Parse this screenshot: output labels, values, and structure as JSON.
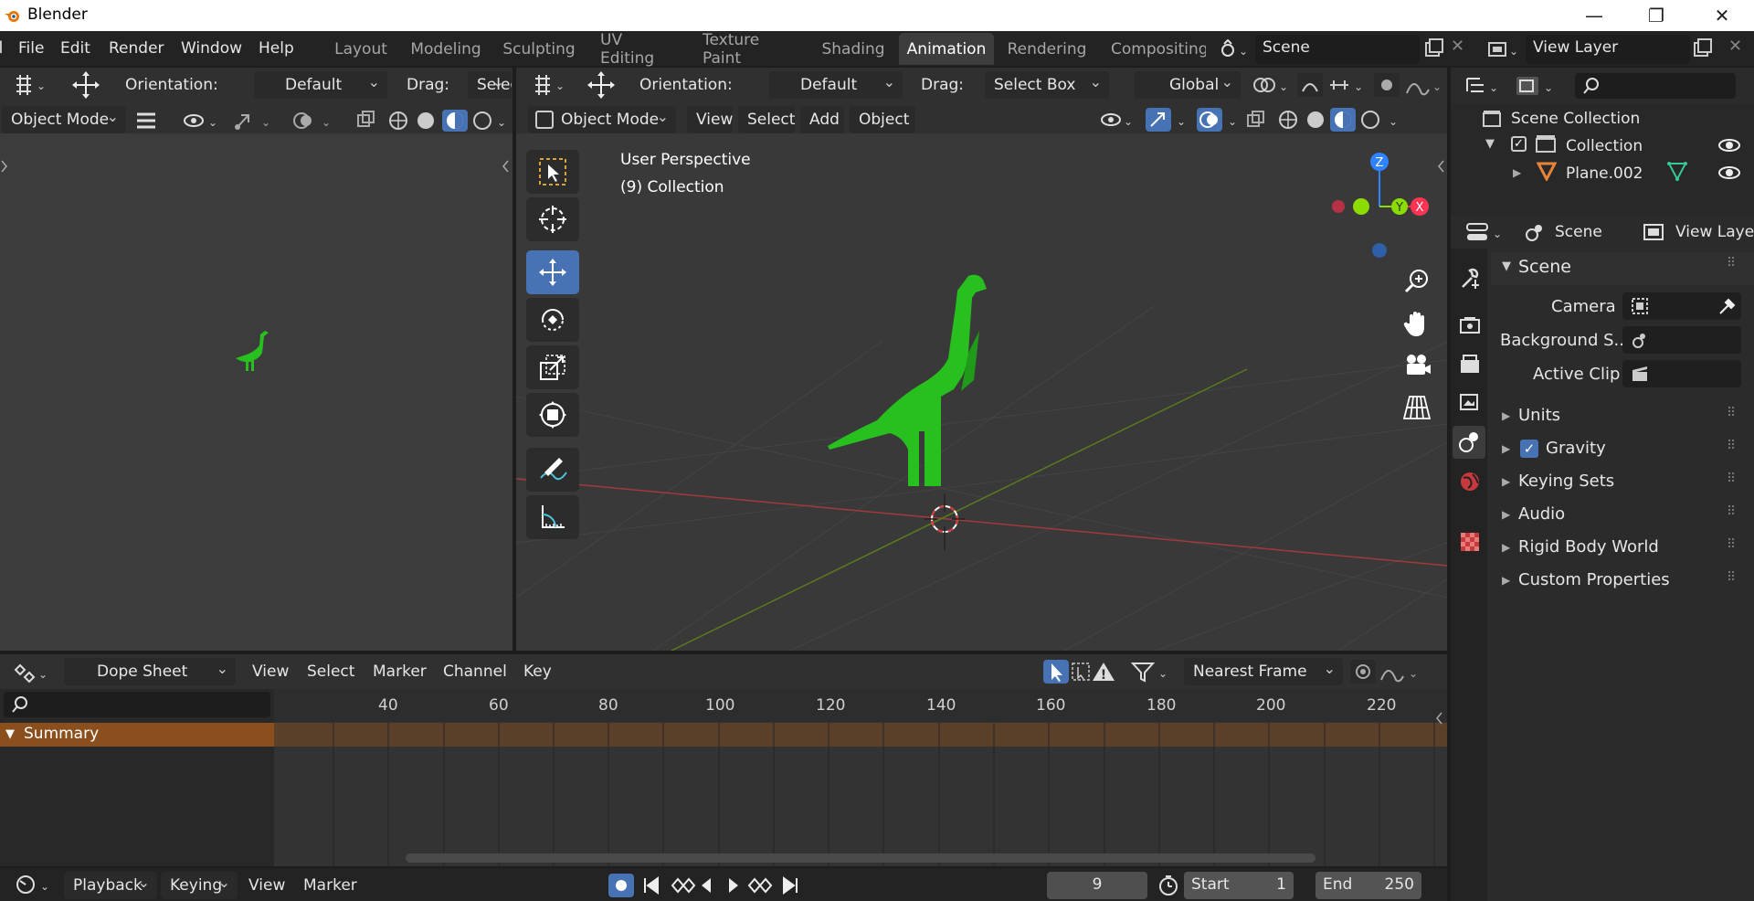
{
  "window": {
    "title": "Blender",
    "minimize": "—",
    "restore": "❐",
    "close": "✕"
  },
  "menu": [
    "File",
    "Edit",
    "Render",
    "Window",
    "Help"
  ],
  "workspaces": {
    "tabs": [
      "Layout",
      "Modeling",
      "Sculpting",
      "UV Editing",
      "Texture Paint",
      "Shading",
      "Animation",
      "Rendering",
      "Compositing"
    ],
    "active": "Animation"
  },
  "scene_selector": {
    "label": "Scene"
  },
  "view_layer_selector": {
    "label": "View Layer"
  },
  "left_viewport": {
    "orientation_label": "Orientation:",
    "orientation_value": "Default",
    "drag_label": "Drag:",
    "drag_value": "Selec",
    "mode": "Object Mode"
  },
  "main_viewport": {
    "orientation_label": "Orientation:",
    "orientation_value": "Default",
    "drag_label": "Drag:",
    "drag_value": "Select Box",
    "transform_space": "Global",
    "mode": "Object Mode",
    "menus": [
      "View",
      "Select",
      "Add",
      "Object"
    ],
    "overlay_text": {
      "perspective": "User Perspective",
      "collection": "(9) Collection"
    },
    "gizmo": {
      "z": "Z",
      "y": "Y",
      "x": "X"
    }
  },
  "outliner": {
    "root": "Scene Collection",
    "collection": "Collection",
    "object": "Plane.002"
  },
  "properties": {
    "tab_scene": "Scene",
    "tab_view_layer": "View Layer",
    "panel_title": "Scene",
    "fields": [
      {
        "label": "Camera"
      },
      {
        "label": "Background S..."
      },
      {
        "label": "Active Clip"
      }
    ],
    "subpanels": [
      "Units",
      "Gravity",
      "Keying Sets",
      "Audio",
      "Rigid Body World",
      "Custom Properties"
    ],
    "gravity_checked": true
  },
  "dopesheet": {
    "mode": "Dope Sheet",
    "menus": [
      "View",
      "Select",
      "Marker",
      "Channel",
      "Key"
    ],
    "snap": "Nearest Frame",
    "frame_ticks": [
      "40",
      "60",
      "80",
      "100",
      "120",
      "140",
      "160",
      "180",
      "200",
      "220"
    ],
    "summary": "Summary"
  },
  "timeline": {
    "menus": [
      "Playback",
      "Keying",
      "View",
      "Marker"
    ],
    "current_frame": "9",
    "start_label": "Start",
    "start_value": "1",
    "end_label": "End",
    "end_value": "250"
  },
  "colors": {
    "accent_blue": "#4772b3",
    "object_green": "#27c01f",
    "axis_x": "#ff3352",
    "axis_y": "#8bdc00",
    "axis_z": "#2f83ff",
    "summary_orange": "#8a4f1c"
  }
}
